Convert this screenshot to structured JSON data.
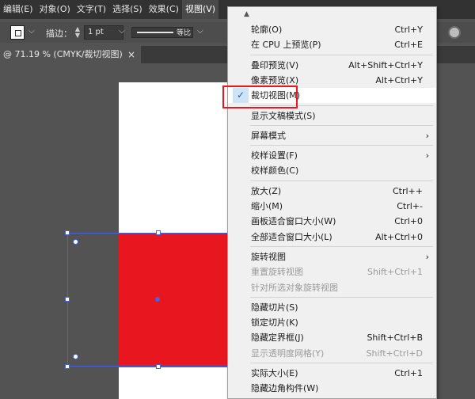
{
  "menubar": {
    "items": [
      "编辑(E)",
      "对象(O)",
      "文字(T)",
      "选择(S)",
      "效果(C)",
      "视图(V)"
    ]
  },
  "control_bar": {
    "stroke_label": "描边：",
    "stroke_value": "1 pt",
    "line_style_label": "等比"
  },
  "document_tab": {
    "title": "@ 71.19 % (CMYK/裁切视图)",
    "close": "×"
  },
  "view_menu": {
    "sections": [
      [
        {
          "label": "轮廓(O)",
          "shortcut": "Ctrl+Y"
        },
        {
          "label": "在 CPU 上预览(P)",
          "shortcut": "Ctrl+E"
        }
      ],
      [
        {
          "label": "叠印预览(V)",
          "shortcut": "Alt+Shift+Ctrl+Y"
        },
        {
          "label": "像素预览(X)",
          "shortcut": "Alt+Ctrl+Y"
        },
        {
          "label": "裁切视图(M)",
          "shortcut": "",
          "checked": true
        }
      ],
      [
        {
          "label": "显示文稿模式(S)",
          "shortcut": ""
        }
      ],
      [
        {
          "label": "屏幕模式",
          "shortcut": "",
          "submenu": true
        }
      ],
      [
        {
          "label": "校样设置(F)",
          "shortcut": "",
          "submenu": true
        },
        {
          "label": "校样颜色(C)",
          "shortcut": ""
        }
      ],
      [
        {
          "label": "放大(Z)",
          "shortcut": "Ctrl++"
        },
        {
          "label": "缩小(M)",
          "shortcut": "Ctrl+-"
        },
        {
          "label": "画板适合窗口大小(W)",
          "shortcut": "Ctrl+0"
        },
        {
          "label": "全部适合窗口大小(L)",
          "shortcut": "Alt+Ctrl+0"
        }
      ],
      [
        {
          "label": "旋转视图",
          "shortcut": "",
          "submenu": true
        },
        {
          "label": "重置旋转视图",
          "shortcut": "Shift+Ctrl+1",
          "disabled": true
        },
        {
          "label": "针对所选对象旋转视图",
          "shortcut": "",
          "disabled": true
        }
      ],
      [
        {
          "label": "隐藏切片(S)",
          "shortcut": ""
        },
        {
          "label": "锁定切片(K)",
          "shortcut": ""
        },
        {
          "label": "隐藏定界框(J)",
          "shortcut": "Shift+Ctrl+B"
        },
        {
          "label": "显示透明度网格(Y)",
          "shortcut": "Shift+Ctrl+D",
          "disabled": true
        }
      ],
      [
        {
          "label": "实际大小(E)",
          "shortcut": "Ctrl+1"
        },
        {
          "label": "隐藏边角构件(W)",
          "shortcut": ""
        }
      ]
    ],
    "check_glyph": "✓",
    "submenu_glyph": "›"
  },
  "colors": {
    "accent_red": "#e8161e",
    "selection_blue": "#4a63d8",
    "check_highlight": "#cfe3f7"
  }
}
